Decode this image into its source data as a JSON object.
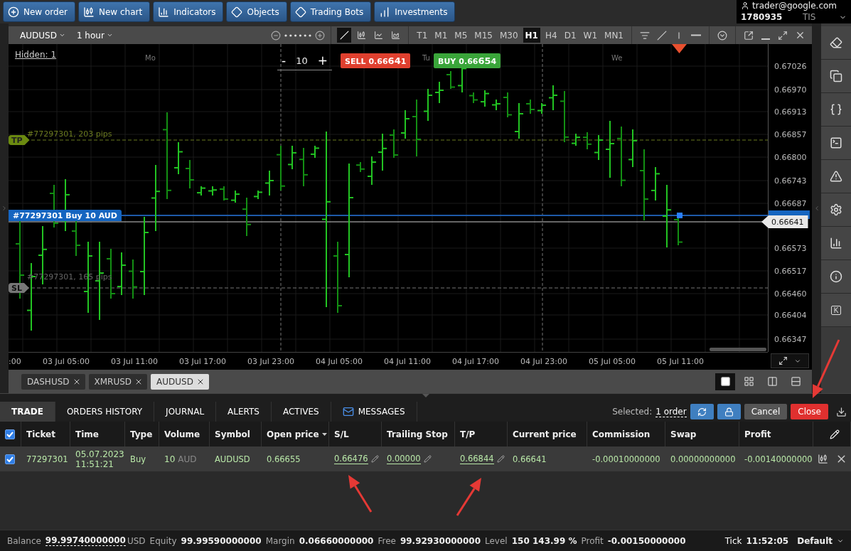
{
  "toolbar": [
    {
      "label": "New order"
    },
    {
      "label": "New chart"
    },
    {
      "label": "Indicators"
    },
    {
      "label": "Objects"
    },
    {
      "label": "Trading Bots"
    },
    {
      "label": "Investments"
    }
  ],
  "account": {
    "email": "trader@google.com",
    "number": "1780935",
    "server": "TIS"
  },
  "chart": {
    "symbol": "AUDUSD",
    "timeframe": "1 hour",
    "chart_types": [
      {
        "selected": true
      },
      {
        "selected": false
      },
      {
        "selected": false
      },
      {
        "selected": false
      }
    ],
    "timeframes": [
      {
        "label": "T1",
        "selected": false
      },
      {
        "label": "M1",
        "selected": false
      },
      {
        "label": "M5",
        "selected": false
      },
      {
        "label": "M15",
        "selected": false
      },
      {
        "label": "M30",
        "selected": false
      },
      {
        "label": "H1",
        "selected": true
      },
      {
        "label": "H4",
        "selected": false
      },
      {
        "label": "D1",
        "selected": false
      },
      {
        "label": "W1",
        "selected": false
      },
      {
        "label": "MN1",
        "selected": false
      }
    ],
    "hidden_link": "Hidden: 1",
    "day_labels": [
      "Mo",
      "Tu",
      "We"
    ],
    "quantity": {
      "minus": "-",
      "value": "10",
      "plus": "+"
    },
    "sell": {
      "label": "SELL",
      "price_start": "0.66",
      "price_big": "64",
      "price_end": "1"
    },
    "buy": {
      "label": "BUY",
      "price_start": "0.66",
      "price_big": "65",
      "price_end": "4"
    },
    "take_profit": {
      "tag": "TP",
      "text": "#77297301, 203 pips"
    },
    "stop_loss": {
      "tag": "SL",
      "text": "#77297301, 165 pips"
    },
    "order_tag": "#77297301 Buy 10 AUD",
    "price_axis": [
      "0.67026",
      "0.66970",
      "0.66913",
      "0.66857",
      "0.66800",
      "0.66743",
      "0.66687",
      "0.66573",
      "0.66517",
      "0.66460",
      "0.66404",
      "0.66347"
    ],
    "current_price": "0.66641",
    "time_axis": [
      ":00",
      "03 Jul 05:00",
      "03 Jul 11:00",
      "03 Jul 17:00",
      "03 Jul 23:00",
      "04 Jul 05:00",
      "04 Jul 11:00",
      "04 Jul 17:00",
      "04 Jul 23:00",
      "05 Jul 05:00",
      "05 Jul 11:00"
    ]
  },
  "chart_tabs": [
    {
      "label": "DASHUSD",
      "selected": false
    },
    {
      "label": "XMRUSD",
      "selected": false
    },
    {
      "label": "AUDUSD",
      "selected": true
    }
  ],
  "layouts": [
    {
      "selected": true
    },
    {
      "selected": false
    },
    {
      "selected": false
    },
    {
      "selected": false
    }
  ],
  "sidebar_key": "K",
  "panel": {
    "tabs": [
      {
        "label": "TRADE",
        "selected": true,
        "kind": "text"
      },
      {
        "label": "ORDERS HISTORY",
        "selected": false,
        "kind": "text"
      },
      {
        "label": "JOURNAL",
        "selected": false,
        "kind": "text"
      },
      {
        "label": "ALERTS",
        "selected": false,
        "kind": "text"
      },
      {
        "label": "ACTIVES",
        "selected": false,
        "kind": "text"
      },
      {
        "label": "MESSAGES",
        "selected": false,
        "kind": "mail"
      }
    ],
    "selected_label": "Selected:",
    "selected_link": "1 order",
    "cancel": "Cancel",
    "close": "Close",
    "select_all_checked": true,
    "columns": [
      {
        "label": "Ticket",
        "sorted": false
      },
      {
        "label": "Time",
        "sorted": false
      },
      {
        "label": "Type",
        "sorted": false
      },
      {
        "label": "Volume",
        "sorted": false
      },
      {
        "label": "Symbol",
        "sorted": false
      },
      {
        "label": "Open price",
        "sorted": true
      },
      {
        "label": "S/L",
        "sorted": false
      },
      {
        "label": "Trailing Stop",
        "sorted": false
      },
      {
        "label": "T/P",
        "sorted": false
      },
      {
        "label": "Current price",
        "sorted": false
      },
      {
        "label": "Commission",
        "sorted": false
      },
      {
        "label": "Swap",
        "sorted": false
      },
      {
        "label": "Profit",
        "sorted": false
      }
    ],
    "rows": [
      {
        "checked": true,
        "ticket": "77297301",
        "date": "05.07.2023",
        "time": "11:51:21",
        "type": "Buy",
        "volume": "10",
        "volume_unit": "AUD",
        "symbol": "AUDUSD",
        "open_price": "0.66655",
        "sl": "0.66476",
        "trailing_stop": "0.00000",
        "tp": "0.66844",
        "current_price": "0.66641",
        "commission": "-0.00010000000",
        "swap": "0.00000000000",
        "profit": "-0.00140000000"
      }
    ]
  },
  "status": [
    {
      "label": "Balance",
      "value": "99.99740000000",
      "unit": "USD"
    },
    {
      "label": "Equity",
      "value": "99.99590000000"
    },
    {
      "label": "Margin",
      "value": "0.06660000000"
    },
    {
      "label": "Free",
      "value": "99.92930000000"
    },
    {
      "label": "Level",
      "value": "150 143.99 %"
    },
    {
      "label": "Profit",
      "value": "-0.00150000000"
    }
  ],
  "tick": {
    "label": "Tick",
    "value": "11:52:05"
  },
  "profile": "Default"
}
